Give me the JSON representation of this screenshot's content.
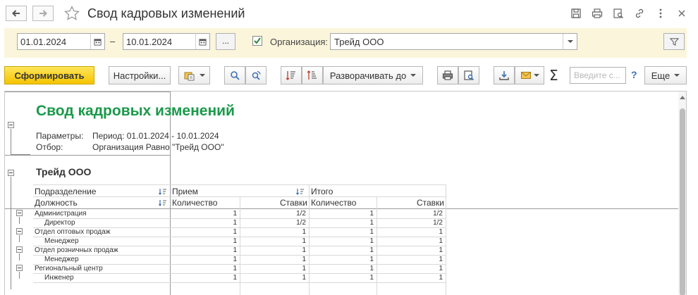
{
  "window": {
    "title": "Свод кадровых изменений"
  },
  "filters": {
    "date_from": "01.01.2024",
    "date_to": "10.01.2024",
    "date_separator": "–",
    "dots_label": "...",
    "org_checked": true,
    "org_label": "Организация:",
    "org_value": "Трейд ООО"
  },
  "toolbar": {
    "generate_label": "Сформировать",
    "settings_label": "Настройки...",
    "expand_label": "Разворачивать до",
    "search_placeholder": "Введите с...",
    "help_label": "?",
    "more_label": "Еще",
    "sigma_label": "Σ"
  },
  "report": {
    "title": "Свод кадровых изменений",
    "params_label": "Параметры:",
    "params_value": "Период: 01.01.2024 - 10.01.2024",
    "filter_label": "Отбор:",
    "filter_value": "Организация Равно \"Трейд ООО\"",
    "org_name": "Трейд ООО",
    "headers": {
      "subdivision": "Подразделение",
      "position": "Должность",
      "hire": "Прием",
      "total": "Итого",
      "count": "Количество",
      "rates": "Ставки",
      "count2": "Количество",
      "rates2": "Ставки"
    },
    "rows": [
      {
        "name": "Администрация",
        "level": 0,
        "c1": "1",
        "r1": "1/2",
        "c2": "1",
        "r2": "1/2"
      },
      {
        "name": "Директор",
        "level": 1,
        "c1": "1",
        "r1": "1/2",
        "c2": "1",
        "r2": "1/2"
      },
      {
        "name": "Отдел оптовых продаж",
        "level": 0,
        "c1": "1",
        "r1": "1",
        "c2": "1",
        "r2": "1"
      },
      {
        "name": "Менеджер",
        "level": 1,
        "c1": "1",
        "r1": "1",
        "c2": "1",
        "r2": "1"
      },
      {
        "name": "Отдел розничных продаж",
        "level": 0,
        "c1": "1",
        "r1": "1",
        "c2": "1",
        "r2": "1"
      },
      {
        "name": "Менеджер",
        "level": 1,
        "c1": "1",
        "r1": "1",
        "c2": "1",
        "r2": "1"
      },
      {
        "name": "Региональный центр",
        "level": 0,
        "c1": "1",
        "r1": "1",
        "c2": "1",
        "r2": "1"
      },
      {
        "name": "Инженер",
        "level": 1,
        "c1": "1",
        "r1": "1",
        "c2": "1",
        "r2": "1"
      }
    ]
  }
}
